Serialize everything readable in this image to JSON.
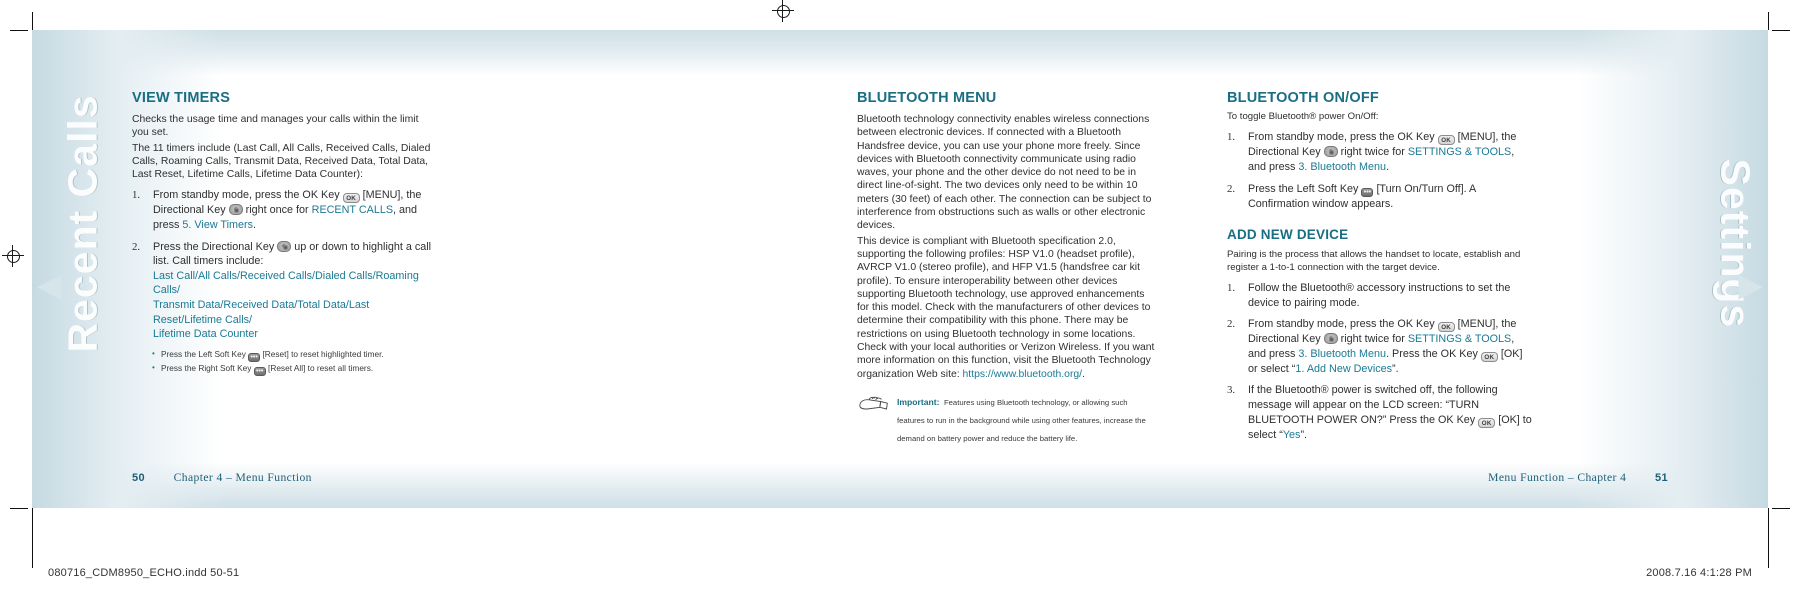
{
  "document": {
    "side_tab_left": "Recent Calls",
    "side_tab_right": "Settings",
    "slug_left": "080716_CDM8950_ECHO.indd   50-51",
    "slug_right": "2008.7.16   4:1:28 PM"
  },
  "left_page": {
    "footer_page": "50",
    "footer_text": "Chapter 4 – Menu Function",
    "section": {
      "heading": "VIEW TIMERS",
      "intro": [
        "Checks the usage time and manages your calls within the limit you set.",
        "The 11 timers include (Last Call, All Calls, Received Calls, Dialed Calls, Roaming Calls, Transmit Data, Received Data, Total Data, Last Reset, Lifetime Calls, Lifetime Data Counter):"
      ],
      "steps": [
        {
          "num": "1.",
          "part1": "From standby mode, press the OK Key",
          "key1": "ok-key",
          "part2": "[MENU], the Directional Key",
          "key2": "directional-key",
          "part3": "right once for",
          "link1": "RECENT CALLS",
          "part4": ", and press",
          "link2": "5. View Timers",
          "part5": "."
        },
        {
          "num": "2.",
          "part1": "Press the Directional Key",
          "key1": "directional-key",
          "part2": "up or down to highlight a call list. Call timers include:",
          "timer_list_line1": "Last Call/All Calls/Received Calls/Dialed Calls/Roaming Calls/",
          "timer_list_line2": "Transmit Data/Received Data/Total Data/Last Reset/Lifetime Calls/",
          "timer_list_line3": "Lifetime Data Counter"
        }
      ],
      "sub_bullets": [
        {
          "pre": "Press the Left Soft Key",
          "key": "left-soft-key",
          "post": "[Reset] to reset highlighted timer."
        },
        {
          "pre": "Press the Right Soft Key",
          "key": "right-soft-key",
          "post": "[Reset All] to reset all timers."
        }
      ]
    }
  },
  "right_page": {
    "footer_page": "51",
    "footer_text": "Menu Function – Chapter 4",
    "column_middle": {
      "heading": "BLUETOOTH MENU",
      "paragraph1": "Bluetooth technology connectivity enables wireless connections between electronic devices. If connected with a Bluetooth Handsfree device, you can use your phone more freely. Since devices with Bluetooth connectivity communicate using radio waves, your phone and the other device do not need to be in direct line-of-sight. The two devices only need to be within 10 meters (30 feet) of each other. The connection can be subject to interference from obstructions such as walls or other electronic devices.",
      "paragraph2_pre": "This device is compliant with Bluetooth specification 2.0, supporting the following profiles: HSP V1.0 (headset profile), AVRCP V1.0 (stereo profile), and HFP V1.5 (handsfree car kit profile). To ensure interoperability between other devices supporting Bluetooth technology, use approved enhancements for this model. Check with the manufacturers of other devices to determine their compatibility with this phone. There may be restrictions on using Bluetooth technology in some locations. Check with your local authorities or Verizon Wireless. If you want more information on this function, visit the Bluetooth Technology organization Web site: ",
      "paragraph2_link": "https://www.bluetooth.org/",
      "paragraph2_post": ".",
      "note": {
        "icon": "note-hand-icon",
        "label": "Important:",
        "text": "Features using Bluetooth technology, or allowing such features to run in the background while using other features, increase the demand on battery power and reduce the battery life."
      }
    },
    "column_right": {
      "heading1": "BLUETOOTH ON/OFF",
      "intro1": "To toggle Bluetooth® power On/Off:",
      "steps1": [
        {
          "num": "1.",
          "part1": "From standby mode, press the OK Key",
          "key1": "ok-key",
          "part2": "[MENU], the Directional Key",
          "key2": "directional-key",
          "part3": "right twice for",
          "link1": "SETTINGS & TOOLS",
          "part4": ", and press",
          "link2": "3. Bluetooth Menu",
          "part5": "."
        },
        {
          "num": "2.",
          "part1": "Press the Left Soft Key",
          "key1": "left-soft-key",
          "part2": "[Turn On/Turn Off]. A Confirmation window appears."
        }
      ],
      "heading2": "ADD NEW DEVICE",
      "intro2": "Pairing is the process that allows the handset to locate, establish and register a 1-to-1 connection with the target device.",
      "steps2": [
        {
          "num": "1.",
          "text": "Follow the Bluetooth® accessory instructions to set the device to pairing mode."
        },
        {
          "num": "2.",
          "part1": "From standby mode, press the OK Key",
          "key1": "ok-key",
          "part2": "[MENU], the Directional Key",
          "key2": "directional-key",
          "part3": "right twice for",
          "link1": "SETTINGS & TOOLS",
          "part4": ", and press",
          "link2": "3. Bluetooth Menu",
          "part5": ". Press the OK Key",
          "key3": "ok-key",
          "part6": "[OK] or select “",
          "link3": "1. Add New Devices",
          "part7": "”."
        },
        {
          "num": "3.",
          "part1": "If the Bluetooth® power is switched off, the following message will appear on the LCD screen: “TURN BLUETOOTH POWER ON?” Press the OK Key",
          "key1": "ok-key",
          "part2": "[OK] to select “",
          "link1": "Yes",
          "part3": "”."
        }
      ]
    }
  },
  "keys": {
    "ok_label": "OK",
    "soft_label": "•••"
  },
  "colors": {
    "teal_heading": "#1a6e84",
    "teal_link": "#1a7a94",
    "footer_blue": "#1f5f78",
    "page_wash": "#cfe0e6"
  }
}
